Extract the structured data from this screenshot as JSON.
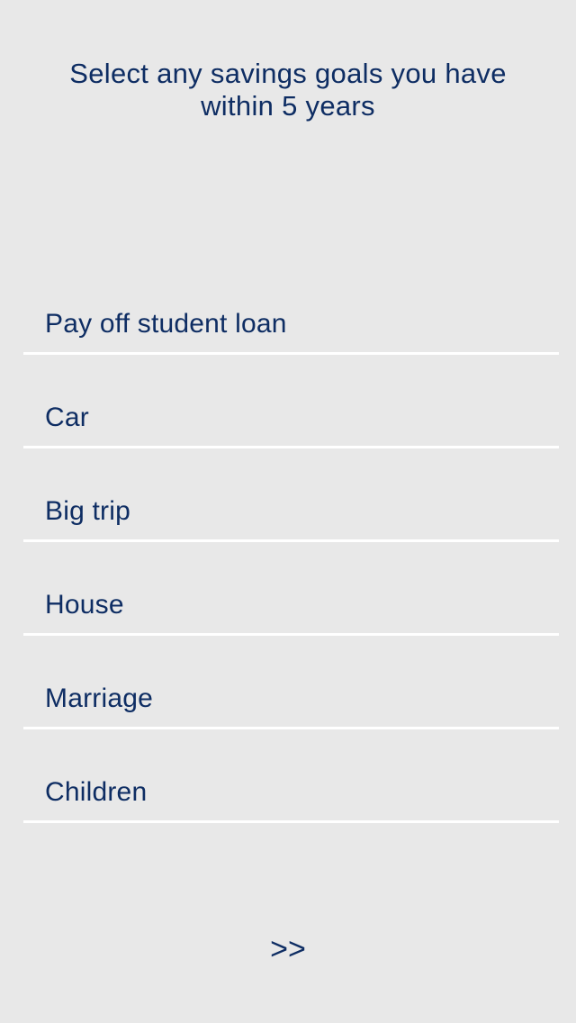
{
  "header": {
    "title": "Select any savings goals you have within 5 years"
  },
  "goals": [
    {
      "label": "Pay off student loan"
    },
    {
      "label": "Car"
    },
    {
      "label": "Big trip"
    },
    {
      "label": "House"
    },
    {
      "label": "Marriage"
    },
    {
      "label": "Children"
    }
  ],
  "footer": {
    "next_label": ">>"
  },
  "colors": {
    "background": "#e8e8e8",
    "text": "#0e2d63",
    "divider": "#ffffff"
  }
}
